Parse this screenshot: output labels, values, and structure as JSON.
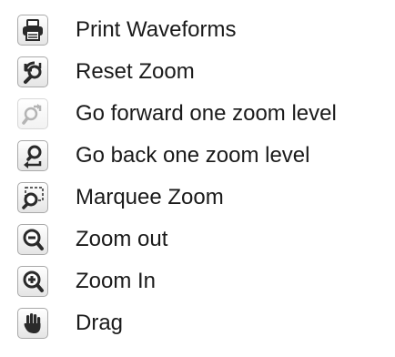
{
  "menu": {
    "items": [
      {
        "label": "Print Waveforms",
        "icon": "print-icon",
        "enabled": true
      },
      {
        "label": "Reset Zoom",
        "icon": "reset-zoom-icon",
        "enabled": true
      },
      {
        "label": "Go forward one zoom level",
        "icon": "zoom-forward-icon",
        "enabled": false
      },
      {
        "label": "Go back one zoom level",
        "icon": "zoom-back-icon",
        "enabled": true
      },
      {
        "label": "Marquee Zoom",
        "icon": "marquee-zoom-icon",
        "enabled": true
      },
      {
        "label": "Zoom out",
        "icon": "zoom-out-icon",
        "enabled": true
      },
      {
        "label": "Zoom In",
        "icon": "zoom-in-icon",
        "enabled": true
      },
      {
        "label": "Drag",
        "icon": "drag-hand-icon",
        "enabled": true
      }
    ]
  },
  "colors": {
    "text": "#1a1a1a",
    "icon": "#2a2a2a",
    "icon_disabled": "#b4b4b4",
    "border": "#a9a9a9"
  }
}
